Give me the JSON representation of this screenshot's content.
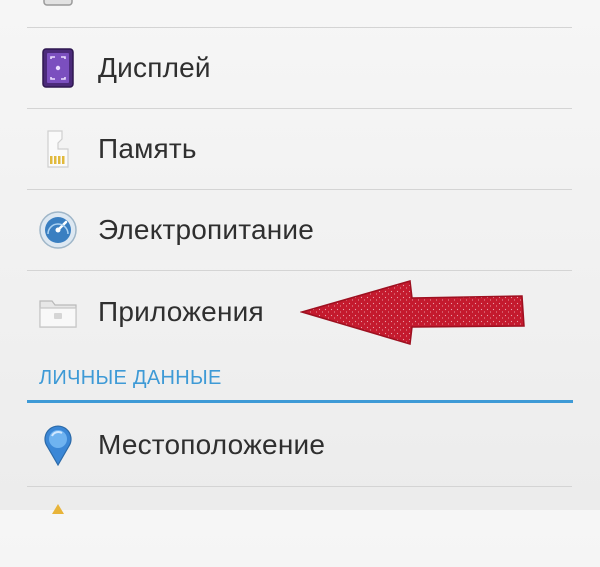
{
  "settings": {
    "items": [
      {
        "label": "",
        "icon": "sound-icon"
      },
      {
        "label": "Дисплей",
        "icon": "display-icon"
      },
      {
        "label": "Память",
        "icon": "storage-icon"
      },
      {
        "label": "Электропитание",
        "icon": "battery-icon"
      },
      {
        "label": "Приложения",
        "icon": "apps-folder-icon"
      }
    ],
    "personal_section": {
      "header": "ЛИЧНЫЕ ДАННЫЕ",
      "items": [
        {
          "label": "Местоположение",
          "icon": "location-icon"
        },
        {
          "label": "",
          "icon": "security-icon"
        }
      ]
    }
  },
  "annotation": {
    "arrow_color": "#c41a2e",
    "arrow_direction": "left"
  },
  "colors": {
    "accent": "#3e9ad6",
    "background": "#f0f0f0",
    "text": "#2f2f2f",
    "divider": "#d4d4d4"
  }
}
